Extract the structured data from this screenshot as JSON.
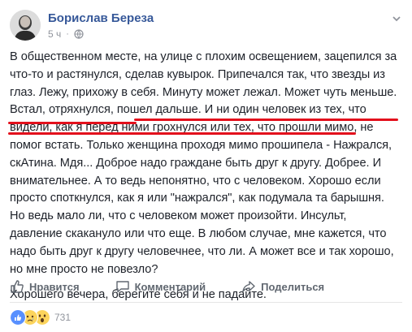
{
  "post": {
    "author": "Борислав Береза",
    "time": "5 ч",
    "privacy_icon": "globe-icon",
    "paragraph1": "В общественном месте, на улице с плохим освещением, зацепился за что-то и растянулся, сделав кувырок. Припечался так, что звезды из глаз. Лежу, прихожу в себя. Минуту может лежал. Может чуть меньше. Встал, отряхнулся, пошел дальше. И ни один человек из тех, что видели, как я перед ними грохнулся или тех, что прошли мимо, не помог встать. Только женщина проходя мимо прошипела - Нажрался, скАтина. Мдя... Доброе надо граждане быть друг к другу. Добрее. И внимательнее. А то ведь непонятно, что с человеком. Хорошо если просто споткнулся, как я или \"нажрался\", как подумала та барышня. Но ведь мало ли, что с человеком может произойти. Инсульт, давление скакануло или что еще. В любом случае, мне кажется, что надо быть друг к другу человечнее, что ли. А может все и так хорошо, но мне просто не повезло?",
    "paragraph2": "Хорошего вечера, берегите себя и не падайте.",
    "highlight_color": "#e3101c"
  },
  "actions": {
    "like": "Нравится",
    "comment": "Комментарий",
    "share": "Поделиться"
  },
  "reactions": {
    "icons": [
      "like-icon",
      "sad-icon",
      "wow-icon"
    ],
    "count": "731"
  },
  "colors": {
    "author": "#365899",
    "text": "#1d2129",
    "muted": "#90949c",
    "like_blue": "#5890ff",
    "emoji_yellow": "#fcd45c"
  }
}
